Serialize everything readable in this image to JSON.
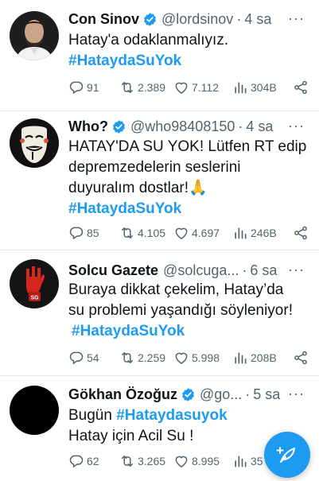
{
  "colors": {
    "accent": "#1d9bf0",
    "text": "#0f1419",
    "secondary": "#536471"
  },
  "tweets": [
    {
      "name": "Con Sinov",
      "handle": "@lordsinov",
      "separator": "·",
      "time": "4 sa",
      "lines": [
        "Hatay'a odaklanmalıyız."
      ],
      "hashtag": "#HataydaSuYok",
      "replies": "91",
      "retweets": "2.389",
      "likes": "7.112",
      "views": "304B"
    },
    {
      "name": "Who?",
      "handle": "@who98408150",
      "separator": "·",
      "time": "4 sa",
      "lines": [
        "HATAY'DA SU YOK! Lütfen RT edip",
        "depremzedelerin seslerini",
        "duyuralım dostlar!🙏"
      ],
      "hashtag": "#HataydaSuYok",
      "replies": "85",
      "retweets": "4.105",
      "likes": "4.697",
      "views": "246B"
    },
    {
      "name": "Solcu Gazete",
      "handle": "@solcuga...",
      "separator": "·",
      "time": "6 sa",
      "lines": [
        "Buraya dikkat çekelim, Hatay’da",
        "su problemi yaşandığı söyleniyor!"
      ],
      "hashtag": "#HataydaSuYok",
      "replies": "54",
      "retweets": "2.259",
      "likes": "5.998",
      "views": "208B"
    },
    {
      "name": "Gökhan Özoğuz",
      "handle": "@go...",
      "separator": "·",
      "time": "5 sa",
      "line_prefix": "Bugün",
      "hashtag": "#Hataydasuyok",
      "lines": [
        "Hatay için Acil Su !"
      ],
      "replies": "62",
      "retweets": "3.265",
      "likes": "8.995",
      "views": "35"
    }
  ],
  "more_label": "···",
  "compose_icon": "feather-plus-icon"
}
